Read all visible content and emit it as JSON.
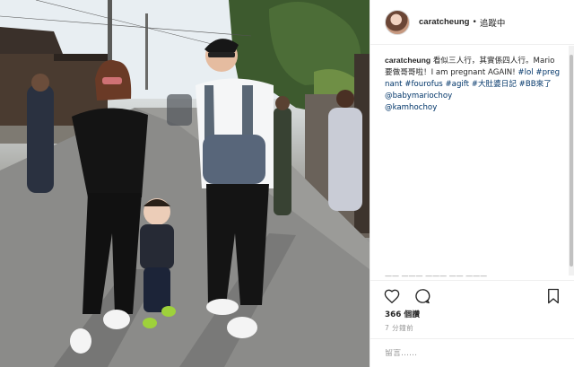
{
  "post": {
    "username": "caratcheung",
    "separator": "•",
    "follow_label": "追蹤中",
    "caption": {
      "user": "caratcheung",
      "text": " 看似三人行，其實係四人行。Mario 要做哥哥啦！I am pregnant AGAIN! ",
      "hashtags": "#lol #pregnant #fourofus #agift #大肚婆日記 #BB來了",
      "mention_1": " @babymariochoy",
      "mention_2": " @kamhochoy"
    },
    "hidden_comment": "—— ——— ——— —— ———",
    "likes": "366 個讚",
    "time_ago": "7 分鐘前",
    "comment_placeholder": "留言……"
  },
  "icons": {
    "like": "heart-icon",
    "comment": "comment-icon",
    "save": "bookmark-icon"
  },
  "colors": {
    "text": "#262626",
    "link": "#003569",
    "muted": "#999999",
    "border": "#efefef"
  }
}
